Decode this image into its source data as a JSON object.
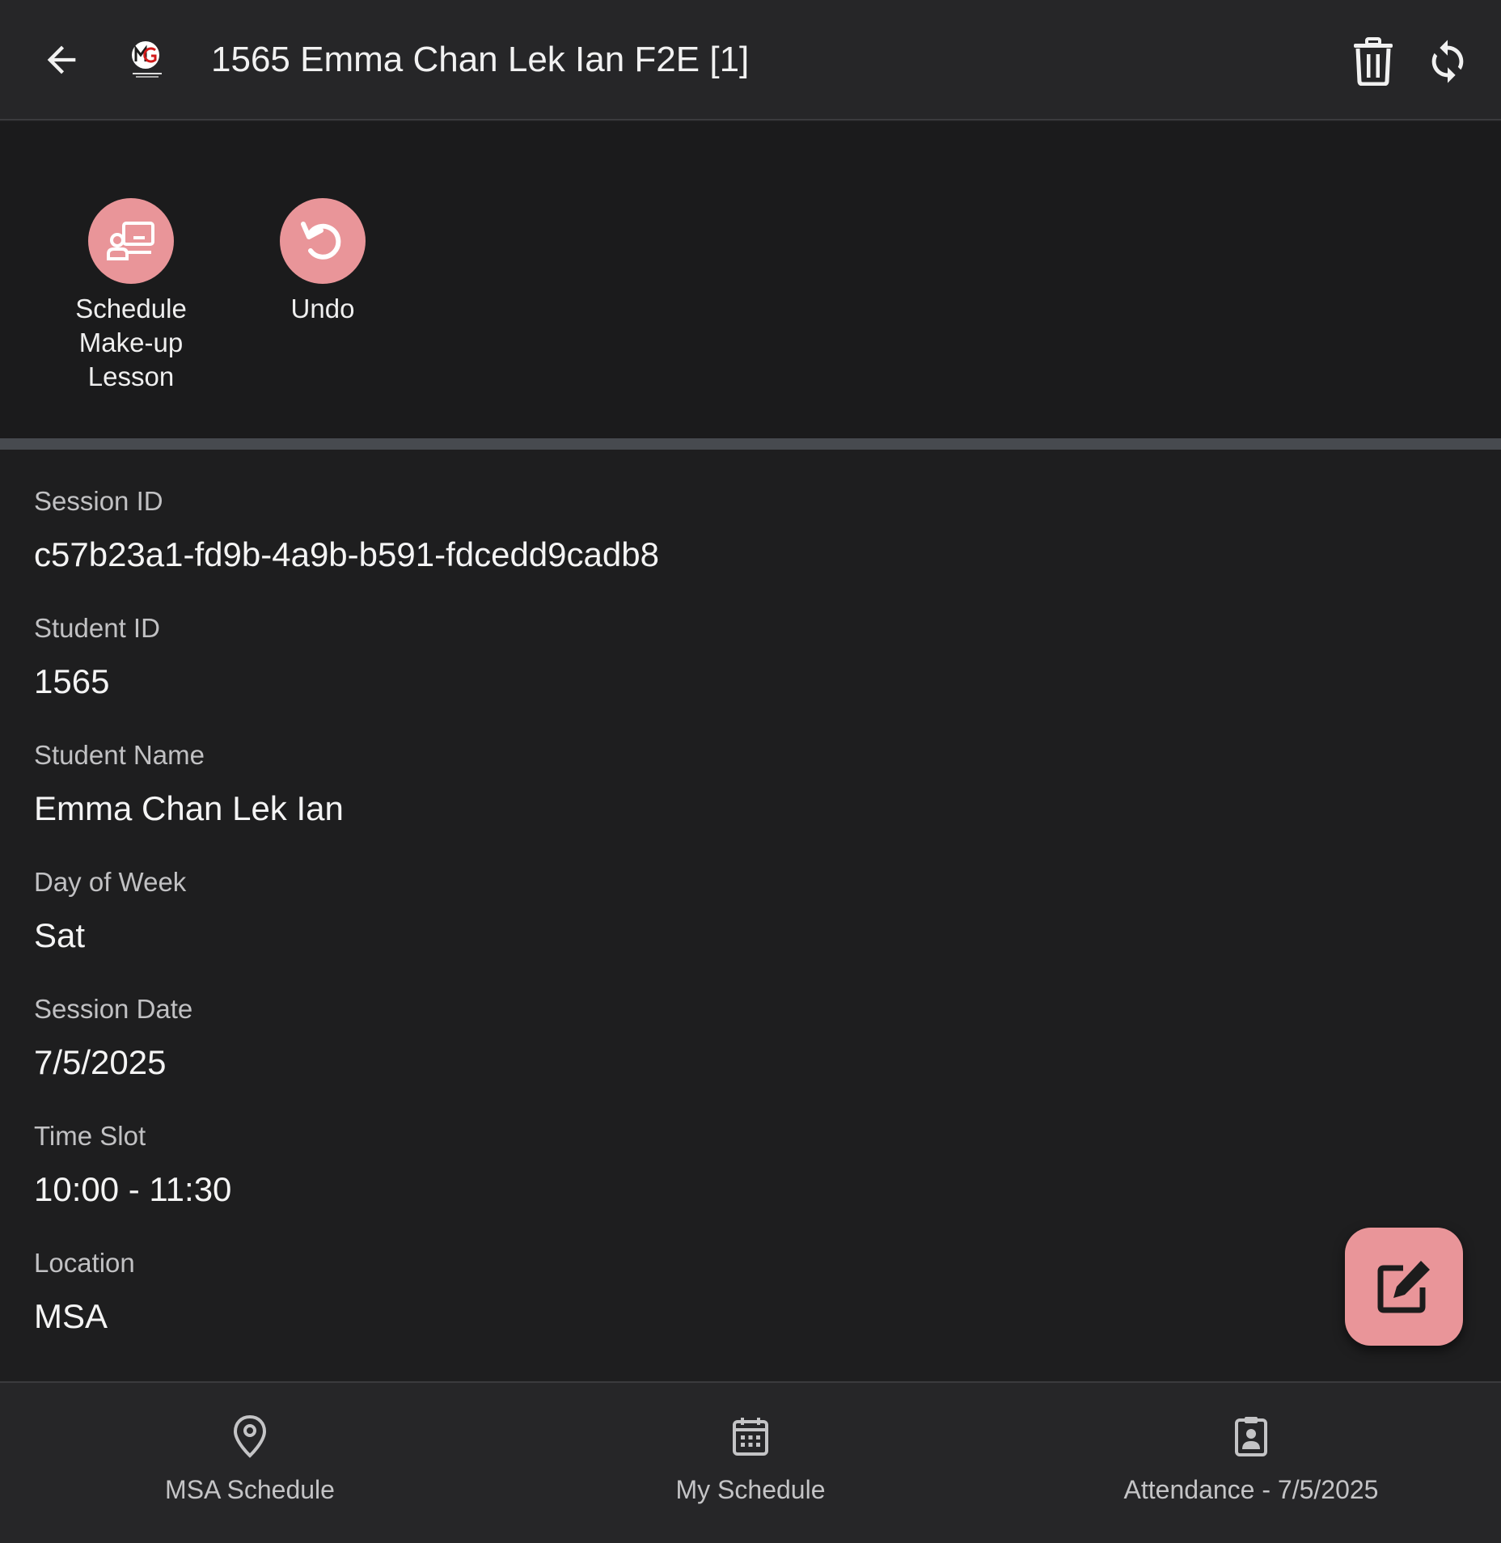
{
  "header": {
    "title": "1565 Emma Chan Lek Ian F2E [1]",
    "icons": [
      "back-arrow-icon",
      "app-logo",
      "trash-icon",
      "sync-icon"
    ]
  },
  "actions": {
    "schedule_makeup": {
      "label": "Schedule\nMake-up\nLesson",
      "icon": "presentation-icon"
    },
    "undo": {
      "label": "Undo",
      "icon": "undo-icon"
    }
  },
  "details": {
    "session_id": {
      "label": "Session ID",
      "value": "c57b23a1-fd9b-4a9b-b591-fdcedd9cadb8"
    },
    "student_id": {
      "label": "Student ID",
      "value": "1565"
    },
    "student_name": {
      "label": "Student Name",
      "value": "Emma Chan Lek Ian"
    },
    "day_of_week": {
      "label": "Day of Week",
      "value": "Sat"
    },
    "session_date": {
      "label": "Session Date",
      "value": "7/5/2025"
    },
    "time_slot": {
      "label": "Time Slot",
      "value": "10:00 - 11:30"
    },
    "location": {
      "label": "Location",
      "value": "MSA"
    }
  },
  "fab": {
    "icon": "edit-icon"
  },
  "bottom_nav": {
    "msa_schedule": {
      "label": "MSA Schedule",
      "icon": "map-pin-icon"
    },
    "my_schedule": {
      "label": "My Schedule",
      "icon": "calendar-icon"
    },
    "attendance": {
      "label": "Attendance - 7/5/2025",
      "icon": "clipboard-user-icon"
    }
  },
  "colors": {
    "background": "#1e1e1f",
    "header": "#262628",
    "accent": "#e99599",
    "divider": "#474a4f"
  }
}
